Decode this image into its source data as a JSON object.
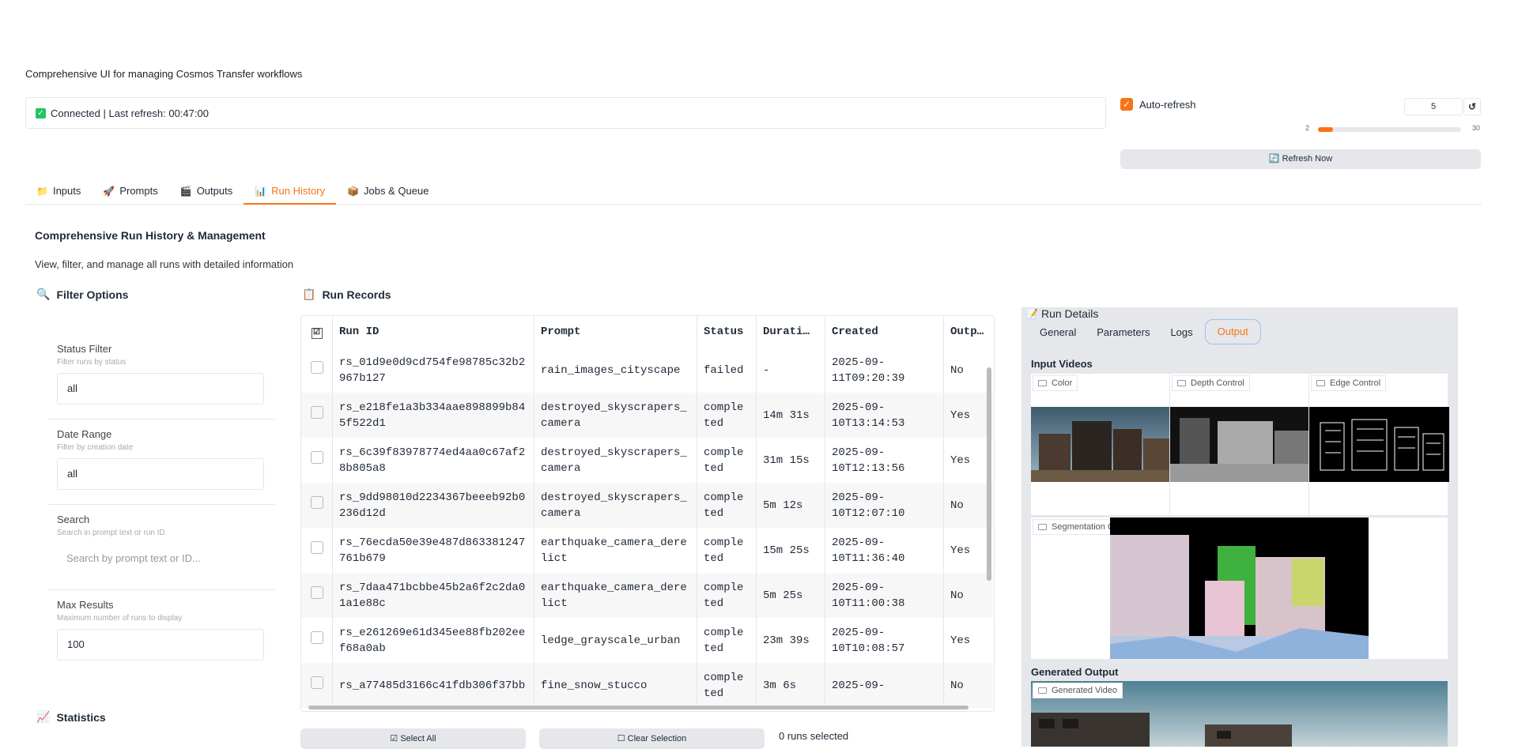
{
  "header": {
    "subtitle": "Comprehensive UI for managing Cosmos Transfer workflows",
    "status_text": "Connected | Last refresh: 00:47:00",
    "auto_refresh_label": "Auto-refresh",
    "auto_refresh_checked": true,
    "interval_value": "5",
    "slider_min": "2",
    "slider_max": "30",
    "slider_fraction": 0.107,
    "refresh_button": "🔄 Refresh Now"
  },
  "tabs": [
    {
      "icon": "📁",
      "label": "Inputs"
    },
    {
      "icon": "🚀",
      "label": "Prompts"
    },
    {
      "icon": "🎬",
      "label": "Outputs"
    },
    {
      "icon": "📊",
      "label": "Run History"
    },
    {
      "icon": "📦",
      "label": "Jobs & Queue"
    }
  ],
  "active_tab": "Run History",
  "main": {
    "title": "Comprehensive Run History & Management",
    "description": "View, filter, and manage all runs with detailed information"
  },
  "filters": {
    "title": "Filter Options",
    "status_label": "Status Filter",
    "status_desc": "Filter runs by status",
    "status_value": "all",
    "date_label": "Date Range",
    "date_desc": "Filter by creation date",
    "date_value": "all",
    "search_label": "Search",
    "search_desc": "Search in prompt text or run ID",
    "search_placeholder": "Search by prompt text or ID...",
    "max_label": "Max Results",
    "max_desc": "Maximum number of runs to display",
    "max_value": "100"
  },
  "statistics_title": "Statistics",
  "records": {
    "title": "Run Records",
    "columns": [
      "☑",
      "Run ID",
      "Prompt",
      "Status",
      "Durati…",
      "Created",
      "Outp…"
    ],
    "rows": [
      {
        "id": "rs_01d9e0d9cd754fe98785c32b2967b127",
        "prompt": "rain_images_cityscape",
        "status": "failed",
        "duration": "-",
        "created": "2025-09-11T09:20:39",
        "output": "No"
      },
      {
        "id": "rs_e218fe1a3b334aae898899b845f522d1",
        "prompt": "destroyed_skyscrapers_camera",
        "status": "completed",
        "duration": "14m 31s",
        "created": "2025-09-10T13:14:53",
        "output": "Yes"
      },
      {
        "id": "rs_6c39f83978774ed4aa0c67af28b805a8",
        "prompt": "destroyed_skyscrapers_camera",
        "status": "completed",
        "duration": "31m 15s",
        "created": "2025-09-10T12:13:56",
        "output": "Yes"
      },
      {
        "id": "rs_9dd98010d2234367beeeb92b0236d12d",
        "prompt": "destroyed_skyscrapers_camera",
        "status": "completed",
        "duration": "5m 12s",
        "created": "2025-09-10T12:07:10",
        "output": "No"
      },
      {
        "id": "rs_76ecda50e39e487d863381247761b679",
        "prompt": "earthquake_camera_derelict",
        "status": "completed",
        "duration": "15m 25s",
        "created": "2025-09-10T11:36:40",
        "output": "Yes"
      },
      {
        "id": "rs_7daa471bcbbe45b2a6f2c2da01a1e88c",
        "prompt": "earthquake_camera_derelict",
        "status": "completed",
        "duration": "5m 25s",
        "created": "2025-09-10T11:00:38",
        "output": "No"
      },
      {
        "id": "rs_e261269e61d345ee88fb202eef68a0ab",
        "prompt": "ledge_grayscale_urban",
        "status": "completed",
        "duration": "23m 39s",
        "created": "2025-09-10T10:08:57",
        "output": "Yes"
      },
      {
        "id": "rs_a77485d3166c41fdb306f37bb",
        "prompt": "fine_snow_stucco",
        "status": "completed",
        "duration": "3m 6s",
        "created": "2025-09-",
        "output": "No"
      }
    ],
    "select_all": "☑ Select All",
    "clear_selection": "☐ Clear Selection",
    "selected_count": "0 runs selected"
  },
  "details": {
    "title": "Run Details",
    "tabs": [
      "General",
      "Parameters",
      "Logs",
      "Output"
    ],
    "active_tab": "Output",
    "input_videos_label": "Input Videos",
    "videos": [
      "Color",
      "Depth Control",
      "Edge Control"
    ],
    "segmentation_label": "Segmentation Control",
    "generated_output_label": "Generated Output",
    "generated_video_label": "Generated Video"
  },
  "colors": {
    "accent": "#f97316",
    "success": "#22c55e",
    "panel": "#e5e7eb"
  }
}
